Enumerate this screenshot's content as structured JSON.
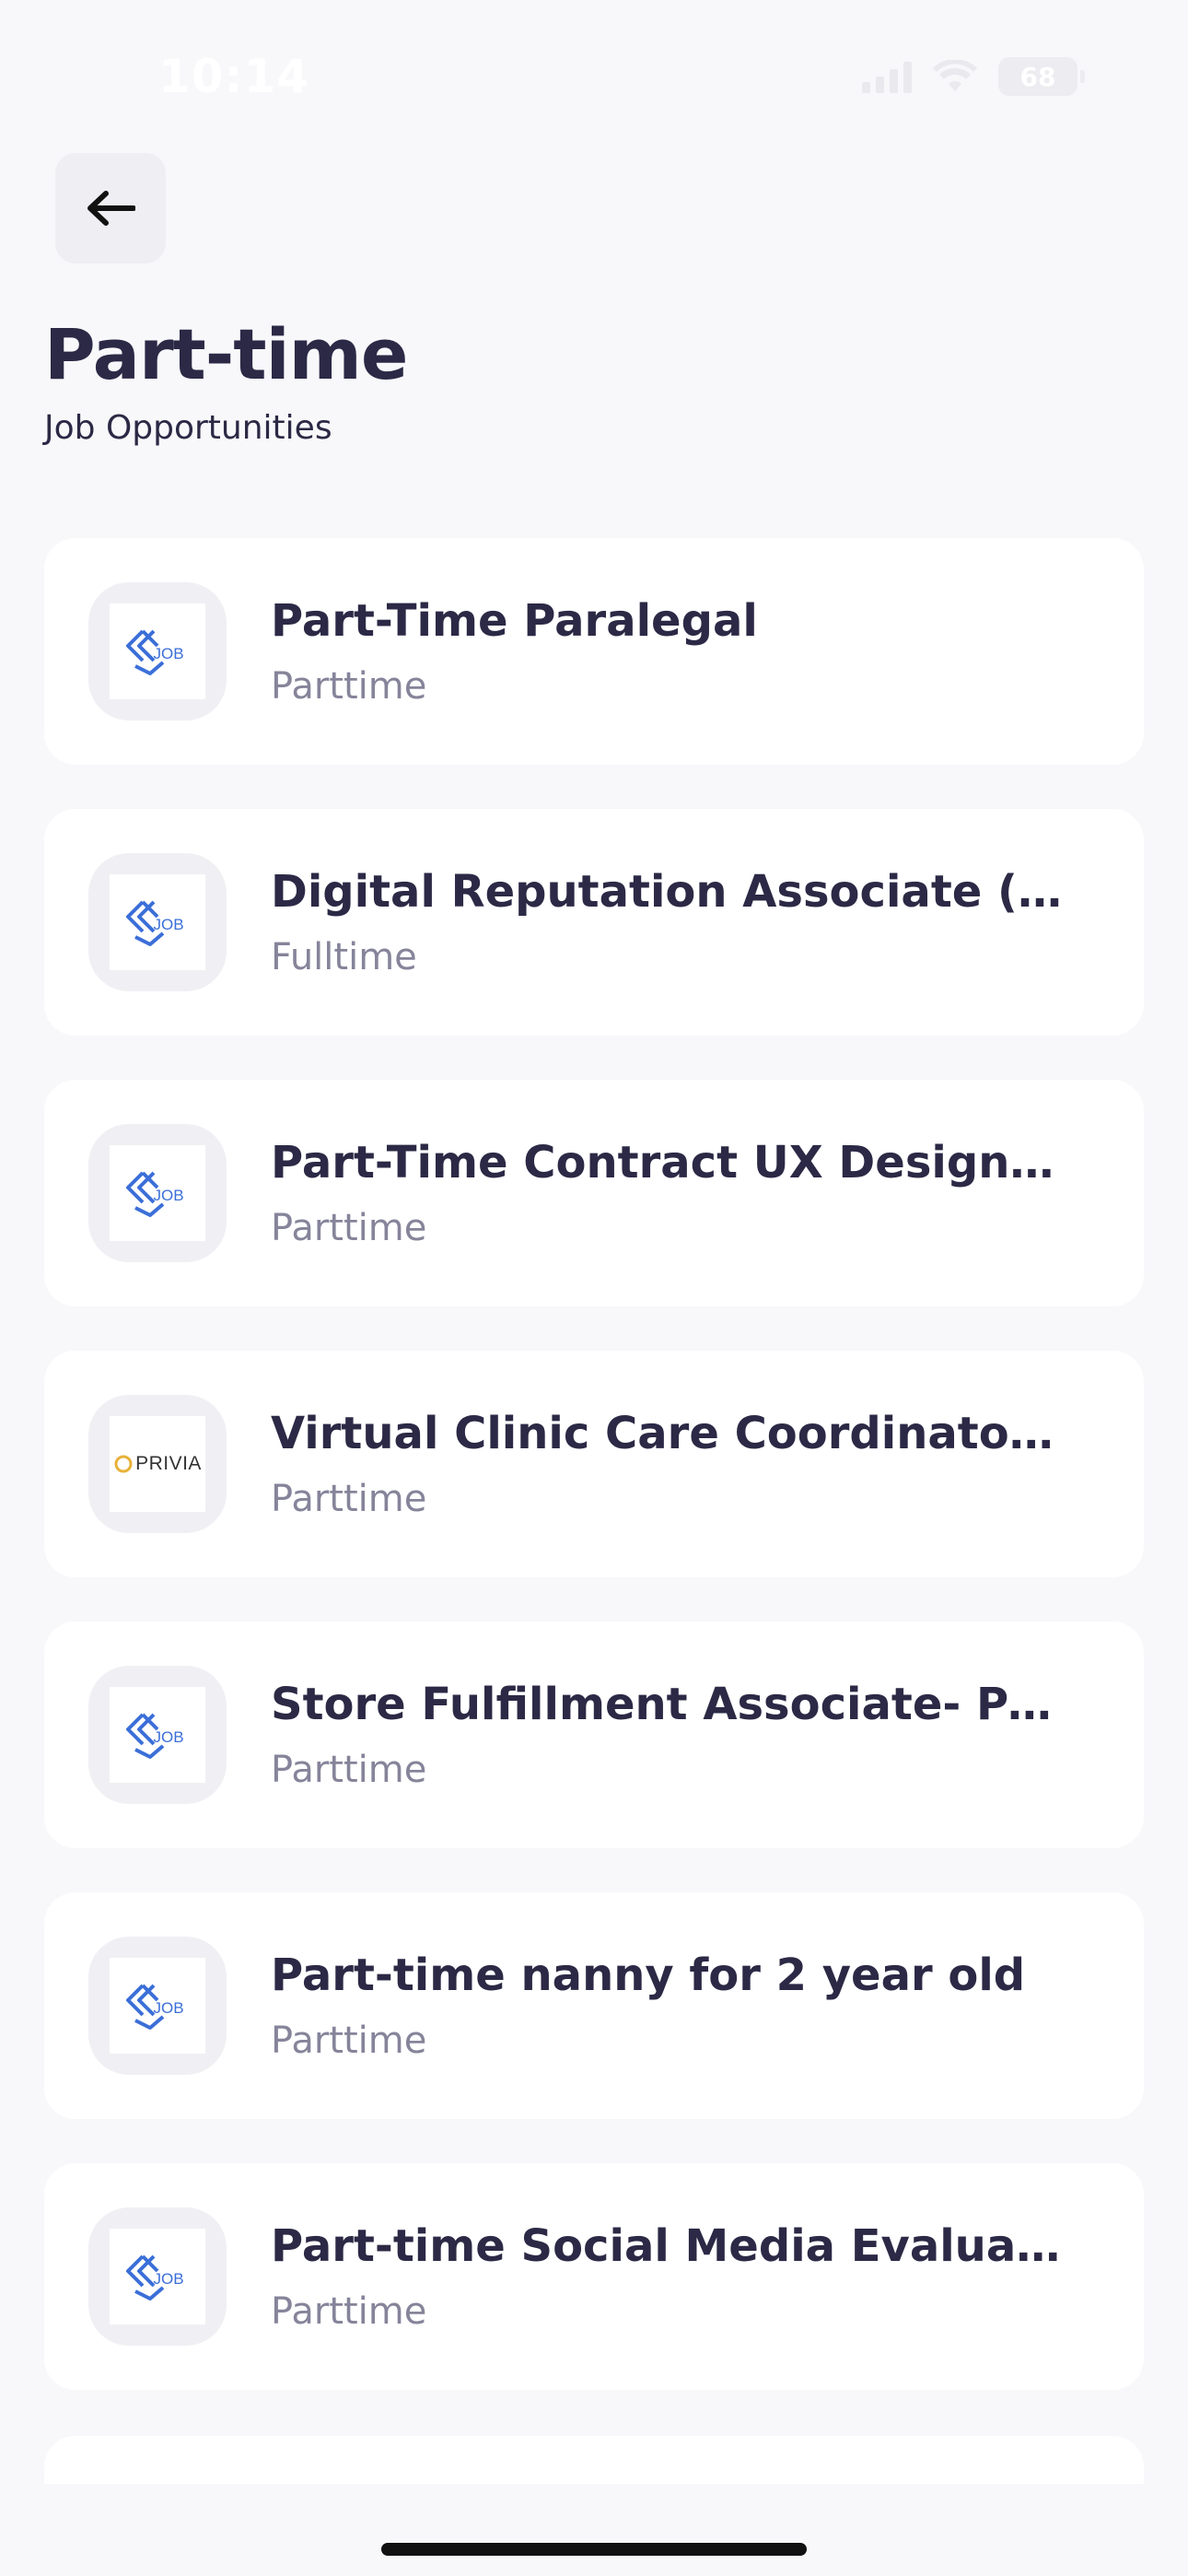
{
  "status_bar": {
    "time": "10:14",
    "battery": "68"
  },
  "header": {
    "title": "Part-time",
    "subtitle": "Job Opportunities"
  },
  "jobs": [
    {
      "title": "Part-Time Paralegal",
      "type": "Parttime",
      "logo": "job-logo",
      "logo_text": "JOB"
    },
    {
      "title": "Digital Reputation Associate (Part-…",
      "type": "Fulltime",
      "logo": "job-logo",
      "logo_text": "JOB"
    },
    {
      "title": "Part-Time Contract UX Designer (R…",
      "type": "Parttime",
      "logo": "job-logo",
      "logo_text": "JOB"
    },
    {
      "title": "Virtual Clinic Care Coordinator Part…",
      "type": "Parttime",
      "logo": "privia-logo",
      "logo_text": "PRIVIA"
    },
    {
      "title": "Store Fulfillment Associate- Part Ti…",
      "type": "Parttime",
      "logo": "job-logo",
      "logo_text": "JOB"
    },
    {
      "title": "Part-time nanny for 2 year old",
      "type": "Parttime",
      "logo": "job-logo",
      "logo_text": "JOB"
    },
    {
      "title": "Part-time Social Media Evaluator",
      "type": "Parttime",
      "logo": "job-logo",
      "logo_text": "JOB"
    }
  ],
  "colors": {
    "background": "#f8f8fb",
    "card": "#ffffff",
    "title_text": "#2b2945",
    "secondary_text": "#85849a",
    "job_logo_blue": "#3b6fd8"
  }
}
